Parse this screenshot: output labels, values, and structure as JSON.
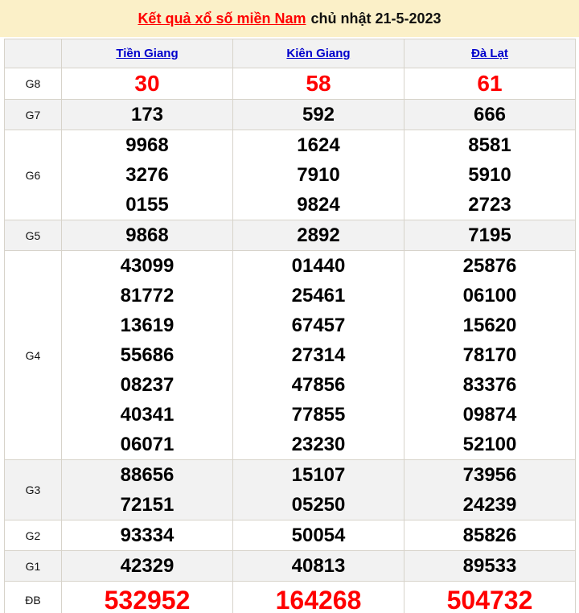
{
  "header": {
    "title_link": "Kết quả xổ số miền Nam",
    "date_text": "chủ nhật 21-5-2023"
  },
  "table": {
    "columns": [
      "Tiền Giang",
      "Kiên Giang",
      "Đà Lạt"
    ],
    "rows": [
      {
        "label": "G8",
        "style": "red-large",
        "zebra": "white",
        "lines": [
          [
            "30",
            "58",
            "61"
          ]
        ]
      },
      {
        "label": "G7",
        "style": "normal",
        "zebra": "gray",
        "lines": [
          [
            "173",
            "592",
            "666"
          ]
        ]
      },
      {
        "label": "G6",
        "style": "normal",
        "zebra": "white",
        "lines": [
          [
            "9968",
            "1624",
            "8581"
          ],
          [
            "3276",
            "7910",
            "5910"
          ],
          [
            "0155",
            "9824",
            "2723"
          ]
        ]
      },
      {
        "label": "G5",
        "style": "normal",
        "zebra": "gray",
        "lines": [
          [
            "9868",
            "2892",
            "7195"
          ]
        ]
      },
      {
        "label": "G4",
        "style": "normal",
        "zebra": "white",
        "lines": [
          [
            "43099",
            "01440",
            "25876"
          ],
          [
            "81772",
            "25461",
            "06100"
          ],
          [
            "13619",
            "67457",
            "15620"
          ],
          [
            "55686",
            "27314",
            "78170"
          ],
          [
            "08237",
            "47856",
            "83376"
          ],
          [
            "40341",
            "77855",
            "09874"
          ],
          [
            "06071",
            "23230",
            "52100"
          ]
        ]
      },
      {
        "label": "G3",
        "style": "normal",
        "zebra": "gray",
        "lines": [
          [
            "88656",
            "15107",
            "73956"
          ],
          [
            "72151",
            "05250",
            "24239"
          ]
        ]
      },
      {
        "label": "G2",
        "style": "normal",
        "zebra": "white",
        "lines": [
          [
            "93334",
            "50054",
            "85826"
          ]
        ]
      },
      {
        "label": "G1",
        "style": "normal",
        "zebra": "gray",
        "lines": [
          [
            "42329",
            "40813",
            "89533"
          ]
        ]
      },
      {
        "label": "ĐB",
        "style": "red-xlarge",
        "zebra": "white",
        "lines": [
          [
            "532952",
            "164268",
            "504732"
          ]
        ]
      }
    ]
  },
  "colors": {
    "title_bar_background": "#FBF0C8",
    "special_prize_red": "#FF0000",
    "link_blue": "#0000CC",
    "stripe_gray": "#F2F2F2",
    "table_border": "#D7D3CA"
  }
}
